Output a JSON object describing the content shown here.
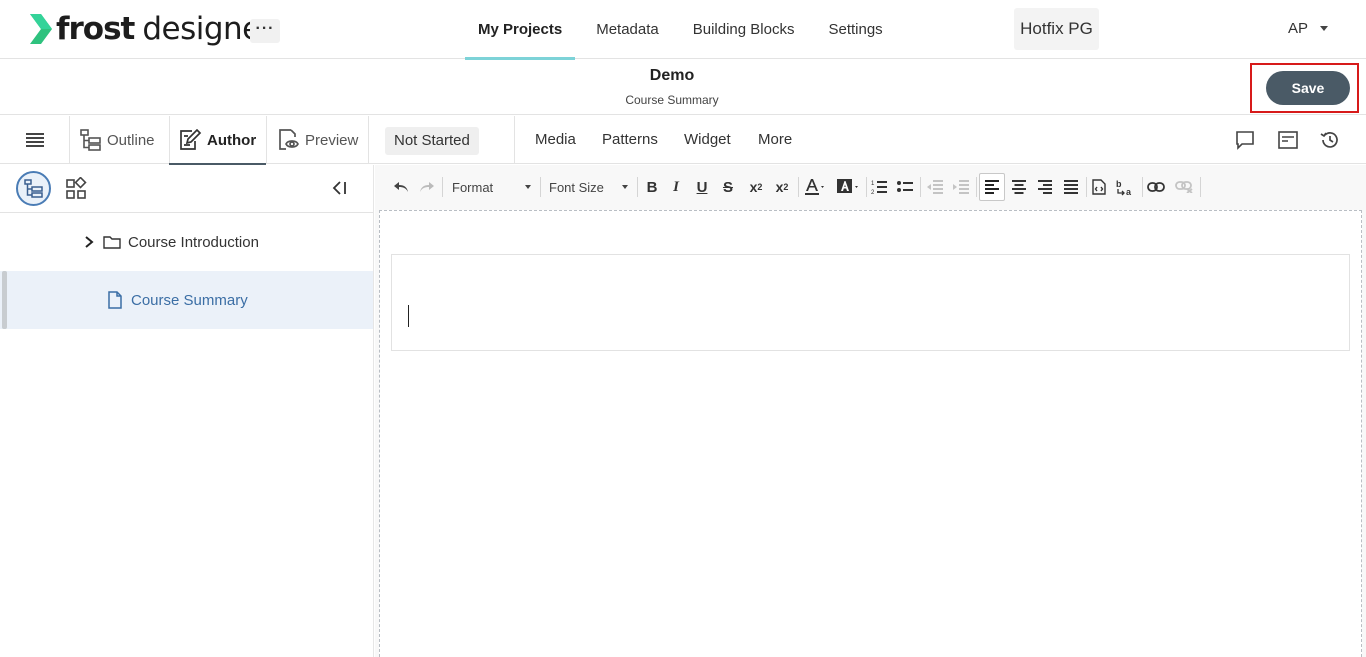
{
  "app": {
    "logo_bold": "frost",
    "logo_text": "designer",
    "more_label": "···"
  },
  "nav": {
    "items": [
      "My Projects",
      "Metadata",
      "Building Blocks",
      "Settings"
    ],
    "active": "My Projects"
  },
  "project": {
    "name": "Hotfix PG"
  },
  "user": {
    "initials": "AP"
  },
  "document": {
    "title": "Demo",
    "subtitle": "Course Summary"
  },
  "actions": {
    "save_label": "Save"
  },
  "modes": {
    "outline": "Outline",
    "author": "Author",
    "preview": "Preview",
    "active": "Author"
  },
  "status": {
    "label": "Not Started"
  },
  "insert_menu": [
    "Media",
    "Patterns",
    "Widget",
    "More"
  ],
  "right_icons": [
    "comment-icon",
    "notes-icon",
    "history-icon"
  ],
  "tree": {
    "items": [
      {
        "label": "Course Introduction",
        "type": "folder",
        "expanded": false,
        "selected": false
      },
      {
        "label": "Course Summary",
        "type": "page",
        "selected": true
      }
    ]
  },
  "editor": {
    "format_label": "Format",
    "font_size_label": "Font Size",
    "active_alignment": "align-left"
  },
  "colors": {
    "accent_underline": "#7dd3d8",
    "save_button": "#4a5a66",
    "highlight_frame": "#d71a1a",
    "selected_row": "#ebf1f9",
    "link_text": "#3b6ea5"
  }
}
